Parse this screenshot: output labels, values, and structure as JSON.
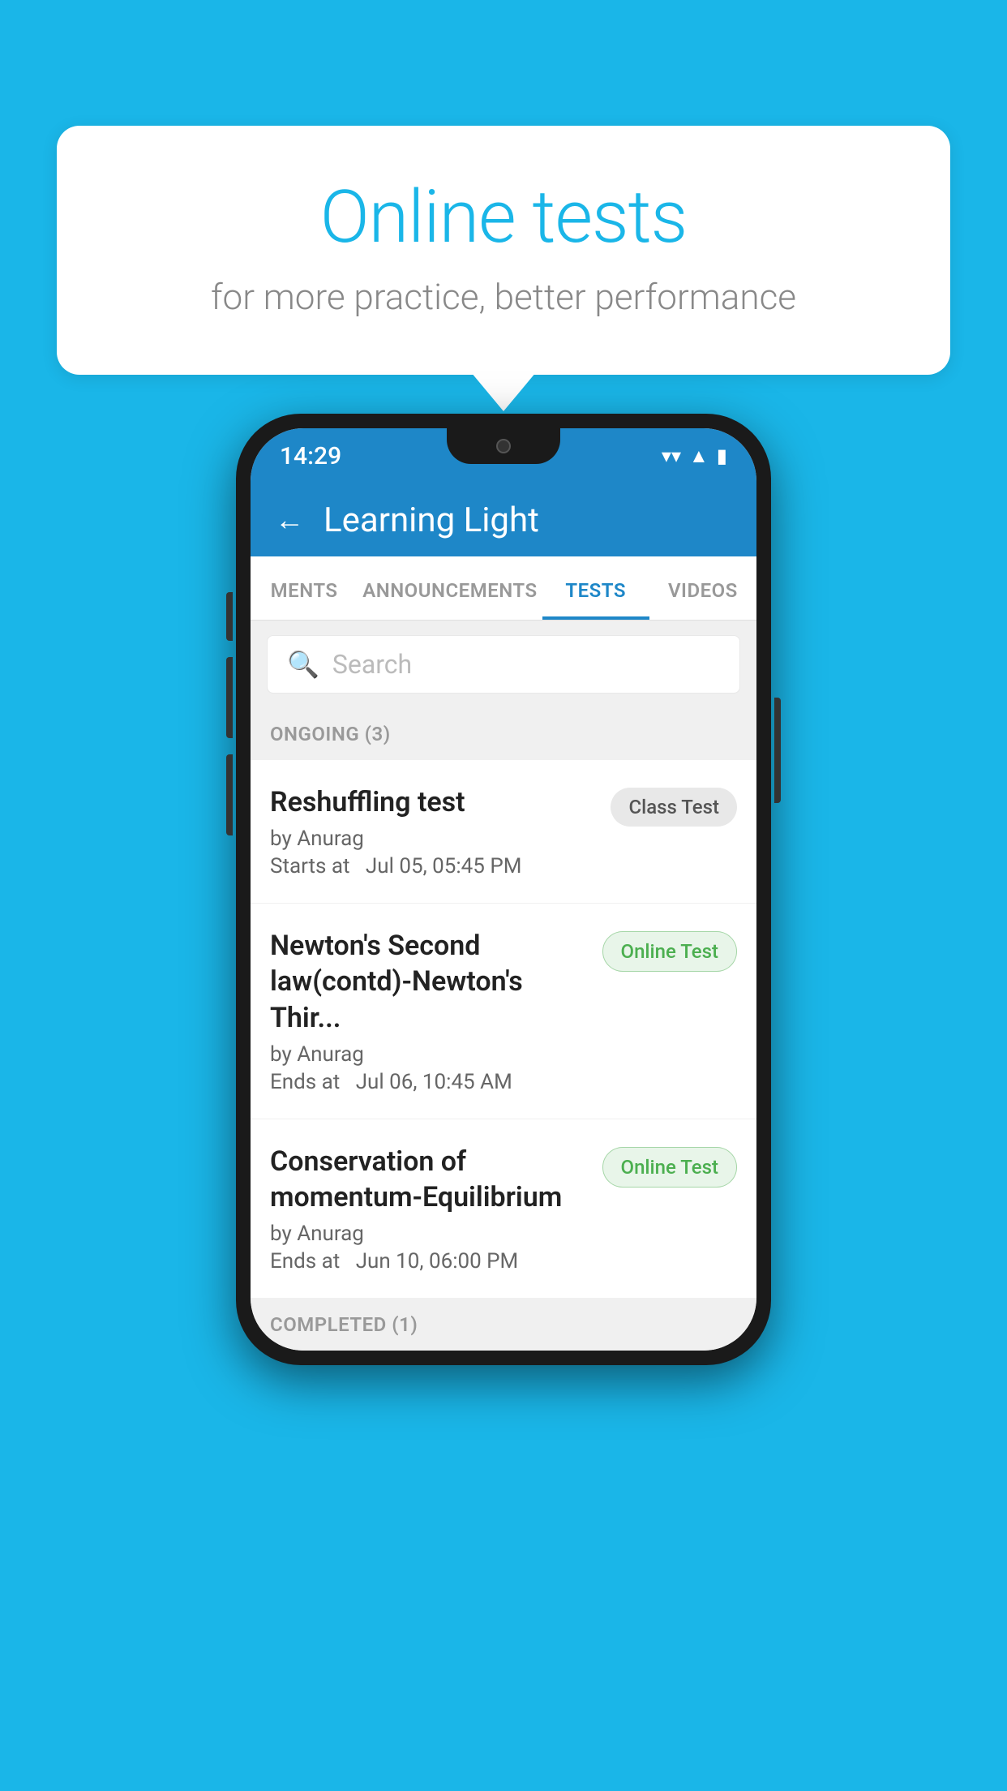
{
  "background_color": "#1ab6e8",
  "speech_bubble": {
    "title": "Online tests",
    "subtitle": "for more practice, better performance"
  },
  "phone": {
    "status_bar": {
      "time": "14:29",
      "icons": [
        "wifi",
        "signal",
        "battery"
      ]
    },
    "app_bar": {
      "back_label": "←",
      "title": "Learning Light"
    },
    "tabs": [
      {
        "label": "MENTS",
        "active": false
      },
      {
        "label": "ANNOUNCEMENTS",
        "active": false
      },
      {
        "label": "TESTS",
        "active": true
      },
      {
        "label": "VIDEOS",
        "active": false
      }
    ],
    "search": {
      "placeholder": "Search"
    },
    "ongoing_section": {
      "label": "ONGOING (3)"
    },
    "tests": [
      {
        "name": "Reshuffling test",
        "by": "by Anurag",
        "date_label": "Starts at",
        "date": "Jul 05, 05:45 PM",
        "badge": "Class Test",
        "badge_type": "class"
      },
      {
        "name": "Newton's Second law(contd)-Newton's Thir...",
        "by": "by Anurag",
        "date_label": "Ends at",
        "date": "Jul 06, 10:45 AM",
        "badge": "Online Test",
        "badge_type": "online"
      },
      {
        "name": "Conservation of momentum-Equilibrium",
        "by": "by Anurag",
        "date_label": "Ends at",
        "date": "Jun 10, 06:00 PM",
        "badge": "Online Test",
        "badge_type": "online"
      }
    ],
    "completed_section": {
      "label": "COMPLETED (1)"
    }
  }
}
